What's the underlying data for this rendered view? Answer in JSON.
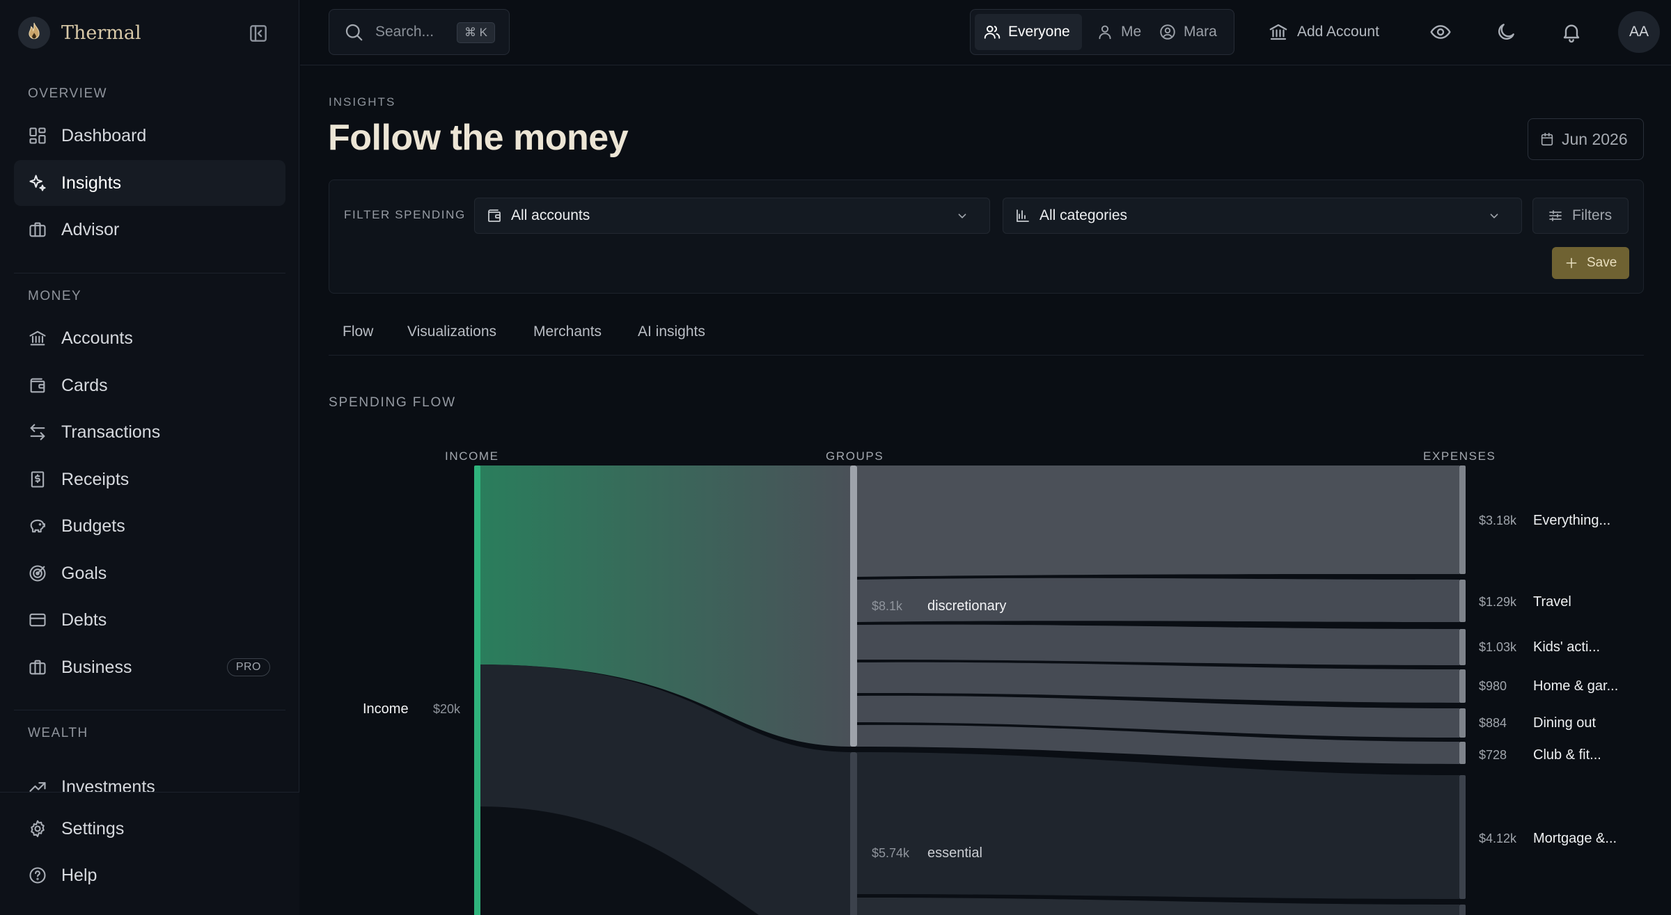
{
  "brand": {
    "name": "Thermal"
  },
  "sidebar": {
    "overview_label": "OVERVIEW",
    "money_label": "MONEY",
    "wealth_label": "WEALTH",
    "items": [
      {
        "label": "Dashboard"
      },
      {
        "label": "Insights"
      },
      {
        "label": "Advisor"
      },
      {
        "label": "Accounts"
      },
      {
        "label": "Cards"
      },
      {
        "label": "Transactions"
      },
      {
        "label": "Receipts"
      },
      {
        "label": "Budgets"
      },
      {
        "label": "Goals"
      },
      {
        "label": "Debts"
      },
      {
        "label": "Business",
        "badge": "PRO"
      },
      {
        "label": "Investments"
      },
      {
        "label": "Settings"
      },
      {
        "label": "Help"
      }
    ]
  },
  "topbar": {
    "search_placeholder": "Search...",
    "search_shortcut": "⌘ K",
    "scope": [
      "Everyone",
      "Me",
      "Mara"
    ],
    "add_account": "Add Account",
    "avatar_initials": "AA"
  },
  "page": {
    "eyebrow": "INSIGHTS",
    "title": "Follow the money",
    "date": "Jun 2026"
  },
  "filters": {
    "label": "FILTER SPENDING",
    "accounts": "All accounts",
    "categories": "All categories",
    "filters_button": "Filters",
    "save_button": "Save"
  },
  "tabs": [
    "Flow",
    "Visualizations",
    "Merchants",
    "AI insights"
  ],
  "flow": {
    "section_title": "SPENDING FLOW",
    "columns": [
      "INCOME",
      "GROUPS",
      "EXPENSES"
    ],
    "income": {
      "label": "Income",
      "amount": "$20k"
    },
    "groups": [
      {
        "label": "discretionary",
        "amount": "$8.1k"
      },
      {
        "label": "essential",
        "amount": "$5.74k"
      }
    ],
    "expenses": [
      {
        "label": "Everything...",
        "amount": "$3.18k"
      },
      {
        "label": "Travel",
        "amount": "$1.29k"
      },
      {
        "label": "Kids' acti...",
        "amount": "$1.03k"
      },
      {
        "label": "Home & gar...",
        "amount": "$980"
      },
      {
        "label": "Dining out",
        "amount": "$884"
      },
      {
        "label": "Club & fit...",
        "amount": "$728"
      },
      {
        "label": "Mortgage &...",
        "amount": "$4.12k"
      }
    ],
    "colors": {
      "income": "#2fb37c",
      "discretionary": "#9ea3ab",
      "essential": "#3c424c",
      "flow_discretionary": "#464b54",
      "flow_essential": "#1f252d"
    }
  }
}
